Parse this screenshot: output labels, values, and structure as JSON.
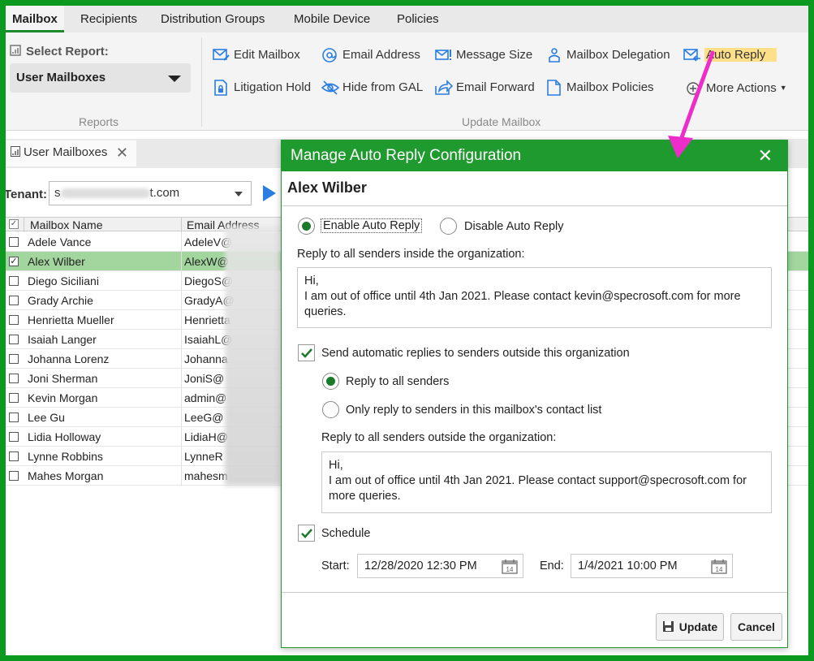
{
  "tabs": [
    {
      "label": "Mailbox"
    },
    {
      "label": "Recipients"
    },
    {
      "label": "Distribution Groups"
    },
    {
      "label": "Mobile Device"
    },
    {
      "label": "Policies"
    }
  ],
  "ribbon": {
    "select_report_label": "Select Report:",
    "report_value": "User Mailboxes",
    "reports_group_label": "Reports",
    "update_group_label": "Update Mailbox",
    "buttons": {
      "edit_mailbox": "Edit Mailbox",
      "email_address": "Email Address",
      "message_size": "Message Size",
      "mailbox_delegation": "Mailbox Delegation",
      "auto_reply": "Auto Reply",
      "litigation_hold": "Litigation Hold",
      "hide_from_gal": "Hide from GAL",
      "email_forward": "Email Forward",
      "mailbox_policies": "Mailbox Policies",
      "more_actions": "More Actions"
    }
  },
  "report_tab": {
    "label": "User Mailboxes",
    "close": "✕"
  },
  "tenant": {
    "label": "Tenant:",
    "prefix": "s",
    "suffix": "t.com"
  },
  "grid": {
    "headers": {
      "name": "Mailbox Name",
      "email": "Email Address"
    },
    "rows": [
      {
        "name": "Adele Vance",
        "email": "AdeleV@",
        "checked": false
      },
      {
        "name": "Alex Wilber",
        "email": "AlexW@",
        "checked": true
      },
      {
        "name": "Diego Siciliani",
        "email": "DiegoS@",
        "checked": false
      },
      {
        "name": "Grady Archie",
        "email": "GradyA@",
        "checked": false
      },
      {
        "name": "Henrietta Mueller",
        "email": "Henrietta",
        "checked": false
      },
      {
        "name": "Isaiah Langer",
        "email": "IsaiahL@",
        "checked": false
      },
      {
        "name": "Johanna Lorenz",
        "email": "Johanna",
        "checked": false
      },
      {
        "name": "Joni Sherman",
        "email": "JoniS@",
        "checked": false
      },
      {
        "name": "Kevin Morgan",
        "email": "admin@",
        "checked": false
      },
      {
        "name": "Lee Gu",
        "email": "LeeG@",
        "checked": false
      },
      {
        "name": "Lidia Holloway",
        "email": "LidiaH@",
        "checked": false
      },
      {
        "name": "Lynne Robbins",
        "email": "LynneR",
        "checked": false
      },
      {
        "name": "Mahes Morgan",
        "email": "mahesm",
        "checked": false
      }
    ]
  },
  "dialog": {
    "title": "Manage Auto Reply Configuration",
    "close": "✕",
    "user_name": "Alex Wilber",
    "enable_label": "Enable Auto Reply",
    "disable_label": "Disable Auto Reply",
    "enabled": true,
    "inside_label": "Reply to all senders inside the organization:",
    "inside_message": [
      "Hi,",
      "I am out of office until 4th Jan 2021. Please contact kevin@specrosoft.com for more queries."
    ],
    "send_outside_label": "Send automatic replies to senders outside this organization",
    "send_outside_checked": true,
    "reply_all_label": "Reply to all senders",
    "reply_contacts_label": "Only reply to senders in this mailbox's contact list",
    "reply_all_selected": true,
    "outside_label": "Reply to all senders outside the organization:",
    "outside_message": [
      "Hi,",
      "I am out of office until 4th Jan 2021. Please contact support@specrosoft.com for more queries."
    ],
    "schedule_label": "Schedule",
    "schedule_checked": true,
    "start_label": "Start:",
    "start_value": "12/28/2020 12:30 PM",
    "end_label": "End:",
    "end_value": "1/4/2021 10:00 PM",
    "update_label": "Update",
    "cancel_label": "Cancel"
  },
  "colors": {
    "frame": "#0b9a1f",
    "dialog_header": "#1f9a2e",
    "selected_row": "#a3d69e",
    "highlight": "#ffe08a",
    "arrow": "#ee2cc9",
    "icon_blue": "#2a7de1"
  },
  "icons": [
    "edit-mailbox-icon",
    "email-address-icon",
    "message-size-icon",
    "mailbox-delegation-icon",
    "auto-reply-icon",
    "litigation-hold-icon",
    "hide-from-gal-icon",
    "email-forward-icon",
    "mailbox-policies-icon",
    "more-actions-icon",
    "calendar-icon",
    "save-icon"
  ]
}
